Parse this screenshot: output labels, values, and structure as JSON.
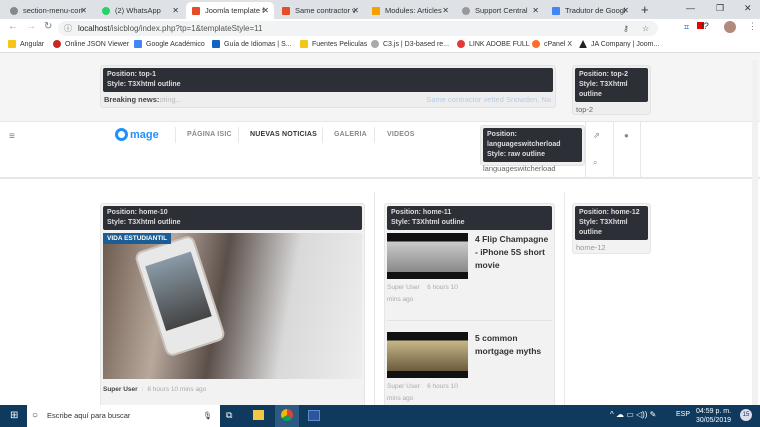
{
  "browser": {
    "tabs": [
      {
        "label": "section-menu-con",
        "color": "#888"
      },
      {
        "label": "(2) WhatsApp",
        "color": "#25d366"
      },
      {
        "label": "Joomla template f",
        "color": "#e44d26"
      },
      {
        "label": "Same contractor v",
        "color": "#e44d26"
      },
      {
        "label": "Modules: Articles",
        "color": "#f4a000"
      },
      {
        "label": "Support Central",
        "color": "#999"
      },
      {
        "label": "Tradutor de Googl",
        "color": "#4285f4"
      }
    ],
    "new_tab": "+",
    "url_host": "localhost",
    "url_path": "/isicblog/index.php?tp=1&templateStyle=11",
    "bookmarks": [
      {
        "label": "Angular",
        "color": "#f5c518"
      },
      {
        "label": "Online JSON Viewer",
        "color": "#c62828"
      },
      {
        "label": "Google Académico",
        "color": "#4285f4"
      },
      {
        "label": "Guía de Idiomas | S...",
        "color": "#1565c0"
      },
      {
        "label": "Fuentes Peliculas",
        "color": "#f5c518"
      },
      {
        "label": "C3.js | D3-based re...",
        "color": "#aaa"
      },
      {
        "label": "LINK ADOBE FULL",
        "color": "#e53935"
      },
      {
        "label": "cPanel X",
        "color": "#ff6c2c"
      },
      {
        "label": "JA Company | Joom...",
        "color": "#222"
      }
    ]
  },
  "top": {
    "top1": {
      "position_label": "Position: ",
      "position": "top-1",
      "style_label": "Style: ",
      "style": "T3Xhtml outline",
      "breaking_label": "Breaking news:",
      "breaking_loading": "oting...",
      "ticker": "Same contractor vetted Snowden, Na"
    },
    "top2": {
      "position_label": "Position: ",
      "position": "top-2",
      "style_label": "Style: ",
      "style": "T3Xhtml outline",
      "content": "top-2"
    }
  },
  "nav": {
    "logo": "mage",
    "items": [
      "PÁGINA ISIC",
      "NUEVAS NOTICIAS",
      "GALERIA",
      "VIDEOS"
    ],
    "lang": {
      "position_label": "Position: ",
      "position": "languageswitcherload",
      "style_label": "Style: ",
      "style": "raw outline",
      "content": "languageswitcherload"
    }
  },
  "home10": {
    "position_label": "Position: ",
    "position": "home-10",
    "style_label": "Style: ",
    "style": "T3Xhtml outline",
    "category": "VIDA ESTUDIANTIL",
    "author": "Super User",
    "time": "6 hours 10 mins ago"
  },
  "home11": {
    "position_label": "Position: ",
    "position": "home-11",
    "style_label": "Style: ",
    "style": "T3Xhtml outline",
    "items": [
      {
        "title": "4 Flip Champagne - iPhone 5S short movie",
        "author": "Super User",
        "time": "6 hours 10 mins ago"
      },
      {
        "title": "5 common mortgage myths",
        "author": "Super User",
        "time": "6 hours 10 mins ago"
      }
    ]
  },
  "home12": {
    "position_label": "Position: ",
    "position": "home-12",
    "style_label": "Style: ",
    "style": "T3Xhtml outline",
    "content": "home-12"
  },
  "taskbar": {
    "search_placeholder": "Escribe aquí para buscar",
    "lang": "ESP",
    "time": "04:59 p. m.",
    "date": "30/05/2019",
    "notifications": "15"
  }
}
